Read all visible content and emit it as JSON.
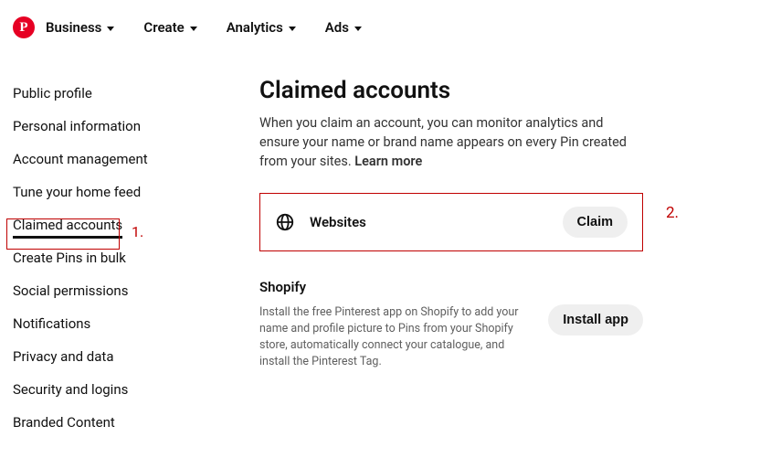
{
  "nav": {
    "items": [
      "Business",
      "Create",
      "Analytics",
      "Ads"
    ]
  },
  "sidebar": {
    "items": [
      "Public profile",
      "Personal information",
      "Account management",
      "Tune your home feed",
      "Claimed accounts",
      "Create Pins in bulk",
      "Social permissions",
      "Notifications",
      "Privacy and data",
      "Security and logins",
      "Branded Content"
    ],
    "activeIndex": 4
  },
  "main": {
    "title": "Claimed accounts",
    "description": "When you claim an account, you can monitor analytics and ensure your name or brand name appears on every Pin created from your sites. ",
    "learnMore": "Learn more",
    "websites": {
      "label": "Websites",
      "button": "Claim"
    },
    "shopify": {
      "title": "Shopify",
      "desc": "Install the free Pinterest app on Shopify to add your name and profile picture to Pins from your Shopify store, automatically connect your catalogue, and install the Pinterest Tag.",
      "button": "Install app"
    }
  },
  "annotations": {
    "one": "1.",
    "two": "2."
  }
}
